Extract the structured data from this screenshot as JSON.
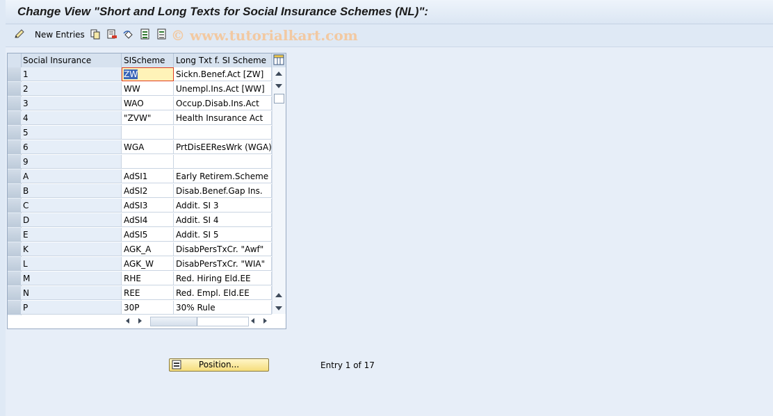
{
  "title": "Change View \"Short and Long Texts for Social Insurance Schemes (NL)\":",
  "toolbar": {
    "new_entries_label": "New Entries",
    "watermark": "© www.tutorialkart.com"
  },
  "table": {
    "columns": [
      "Social Insurance",
      "SIScheme",
      "Long Txt f. SI Scheme"
    ],
    "rows": [
      [
        "1",
        "ZW",
        "Sickn.Benef.Act [ZW]"
      ],
      [
        "2",
        "WW",
        "Unempl.Ins.Act [WW]"
      ],
      [
        "3",
        "WAO",
        "Occup.Disab.Ins.Act"
      ],
      [
        "4",
        "\"ZVW\"",
        "Health Insurance Act"
      ],
      [
        "5",
        "",
        ""
      ],
      [
        "6",
        "WGA",
        "PrtDisEEResWrk (WGA)"
      ],
      [
        "9",
        "",
        ""
      ],
      [
        "A",
        "AdSI1",
        "Early Retirem.Scheme"
      ],
      [
        "B",
        "AdSI2",
        "Disab.Benef.Gap Ins."
      ],
      [
        "C",
        "AdSI3",
        "Addit. SI 3"
      ],
      [
        "D",
        "AdSI4",
        "Addit. SI 4"
      ],
      [
        "E",
        "AdSI5",
        "Addit. SI 5"
      ],
      [
        "K",
        "AGK_A",
        "DisabPersTxCr. \"Awf\""
      ],
      [
        "L",
        "AGK_W",
        "DisabPersTxCr. \"WIA\""
      ],
      [
        "M",
        "RHE",
        "Red. Hiring Eld.EE"
      ],
      [
        "N",
        "REE",
        "Red. Empl. Eld.EE"
      ],
      [
        "P",
        "30P",
        "30% Rule"
      ]
    ]
  },
  "position_button_label": "Position...",
  "entry_info": "Entry 1 of 17",
  "colors": {
    "background": "#dfe9f5",
    "button_yellow": "#f5dd7c",
    "focus_outline": "#e03c1e"
  }
}
